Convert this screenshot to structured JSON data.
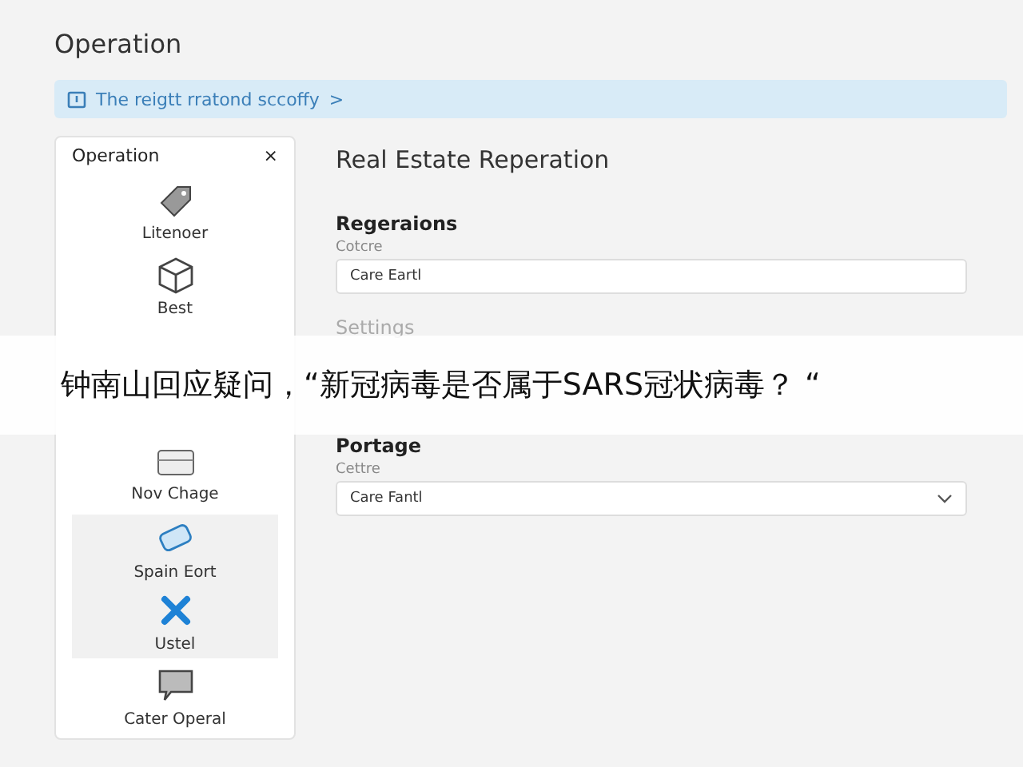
{
  "page": {
    "title": "Operation"
  },
  "info_bar": {
    "text": "The reigtt rratond sccoffy",
    "arrow": ">"
  },
  "sidebar": {
    "title": "Operation",
    "close": "×",
    "items": [
      {
        "label": "Litenoer",
        "kind": "tag",
        "selected": false
      },
      {
        "label": "Best",
        "kind": "cube",
        "selected": false
      },
      {
        "label": "Nov Chage",
        "kind": "tray",
        "selected": false
      },
      {
        "label": "Spain Eort",
        "kind": "card",
        "selected": true
      },
      {
        "label": "Ustel",
        "kind": "cross",
        "selected": true
      },
      {
        "label": "Cater Operal",
        "kind": "comment",
        "selected": false
      }
    ]
  },
  "main": {
    "title": "Real Estate Reperation",
    "sections": [
      {
        "heading": "Regeraions",
        "label": "Cotcre",
        "value": "Care Eartl",
        "kind": "text"
      },
      {
        "heading": "Settings",
        "kind": "heading"
      },
      {
        "heading": "Portage",
        "label": "Cettre",
        "value": "Care Fantl",
        "kind": "select"
      }
    ]
  },
  "caption_banner": {
    "text": "钟南山回应疑问，“新冠病毒是否属于SARS冠状病毒？ “"
  }
}
